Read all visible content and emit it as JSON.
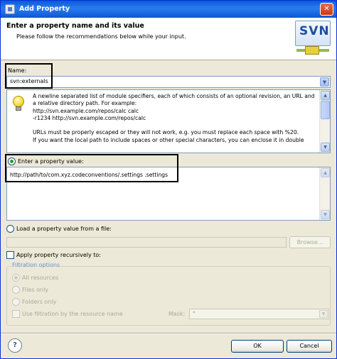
{
  "window": {
    "title": "Add Property",
    "close_glyph": "✕"
  },
  "banner": {
    "heading": "Enter a property name and its value",
    "subheading": "Please follow the recommendations below while your input.",
    "logo_text": "SVN"
  },
  "name": {
    "label": "Name:",
    "value": "svn:externals",
    "arrow": "▼"
  },
  "description": {
    "lines": [
      "A newline separated list of module specifiers, each of which consists of an optional revision, an URL and",
      "a relative directory path. For example:",
      "http://svn.example.com/repos/calc calc",
      "-r1234 http://svn.example.com/repos/calc",
      "",
      "URLs must be properly escaped or they will not work, e.g. you must replace each space with %20.",
      "If you want the local path to include spaces or other special characters, you can enclose it in double"
    ],
    "scroll_up": "▲",
    "scroll_down": "▼"
  },
  "property_value": {
    "radio_label": "Enter a property value:",
    "selected": true,
    "value": "http://path/to/com.xyz.codeconventions/.settings .settings"
  },
  "load_file": {
    "radio_label": "Load a property value from a file:",
    "selected": false,
    "path": "",
    "browse_label": "Browse..."
  },
  "recursive": {
    "checkbox_label": "Apply property recursively to:",
    "checked": false
  },
  "filtration": {
    "title": "Filtration options",
    "options": [
      {
        "label": "All resources",
        "selected": true
      },
      {
        "label": "Files only",
        "selected": false
      },
      {
        "label": "Folders only",
        "selected": false
      }
    ],
    "use_filter_label": "Use filtration by the resource name",
    "mask_label": "Mask:",
    "mask_value": "*",
    "mask_arrow": "▼"
  },
  "footer": {
    "help_glyph": "?",
    "ok_label": "OK",
    "cancel_label": "Cancel"
  }
}
